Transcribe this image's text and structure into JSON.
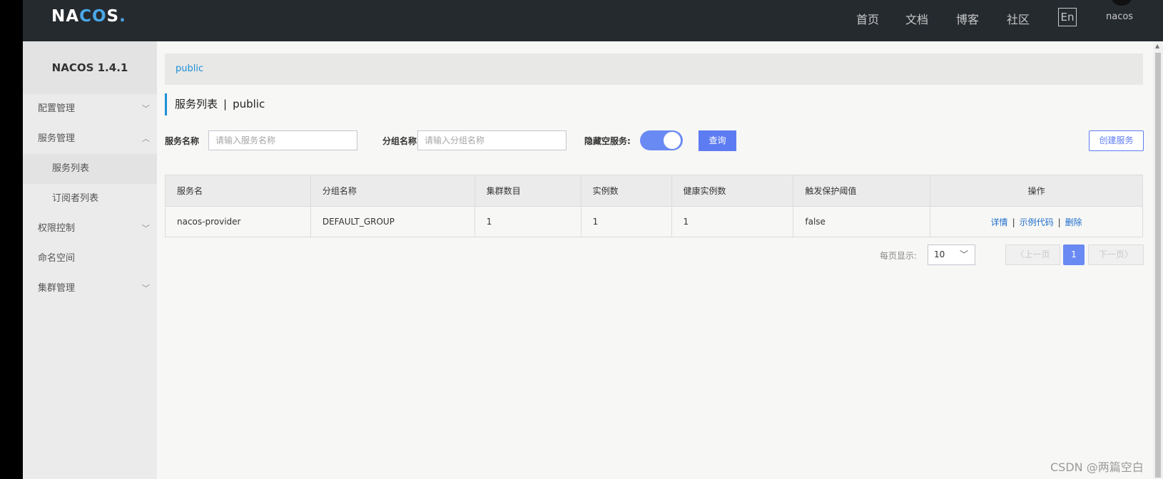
{
  "header": {
    "logo": {
      "n": "N",
      "a": "A",
      "c": "C",
      "o": "O",
      "s": "S",
      "dot": "."
    },
    "nav": [
      "首页",
      "文档",
      "博客",
      "社区"
    ],
    "lang": "En",
    "user": "nacos"
  },
  "sidebar": {
    "title": "NACOS 1.4.1",
    "items": [
      {
        "label": "配置管理"
      },
      {
        "label": "服务管理"
      },
      {
        "label": "服务列表"
      },
      {
        "label": "订阅者列表"
      },
      {
        "label": "权限控制"
      },
      {
        "label": "命名空间"
      },
      {
        "label": "集群管理"
      }
    ]
  },
  "breadcrumb": {
    "namespace": "public"
  },
  "page": {
    "title": "服务列表",
    "sep": "|",
    "namespace": "public"
  },
  "filters": {
    "service_name_label": "服务名称",
    "service_name_placeholder": "请输入服务名称",
    "group_name_label": "分组名称",
    "group_name_placeholder": "请输入分组名称",
    "hide_empty_label": "隐藏空服务:",
    "hide_empty_on": true,
    "query_button": "查询",
    "create_button": "创建服务"
  },
  "table": {
    "columns": [
      "服务名",
      "分组名称",
      "集群数目",
      "实例数",
      "健康实例数",
      "触发保护阈值",
      "操作"
    ],
    "rows": [
      {
        "cells": [
          "nacos-provider",
          "DEFAULT_GROUP",
          "1",
          "1",
          "1",
          "false"
        ],
        "actions": [
          "详情",
          "示例代码",
          "删除"
        ],
        "sep": "|"
      }
    ]
  },
  "pagination": {
    "page_size_label": "每页显示:",
    "page_size": "10",
    "prev": "上一页",
    "next": "下一页",
    "current": "1"
  },
  "watermark": "CSDN @两篇空白",
  "colors": {
    "topbar": "#252a2f",
    "accent": "#5d7cf2",
    "link": "#1e6ecc",
    "breadcrumb": "#1e90d6"
  }
}
